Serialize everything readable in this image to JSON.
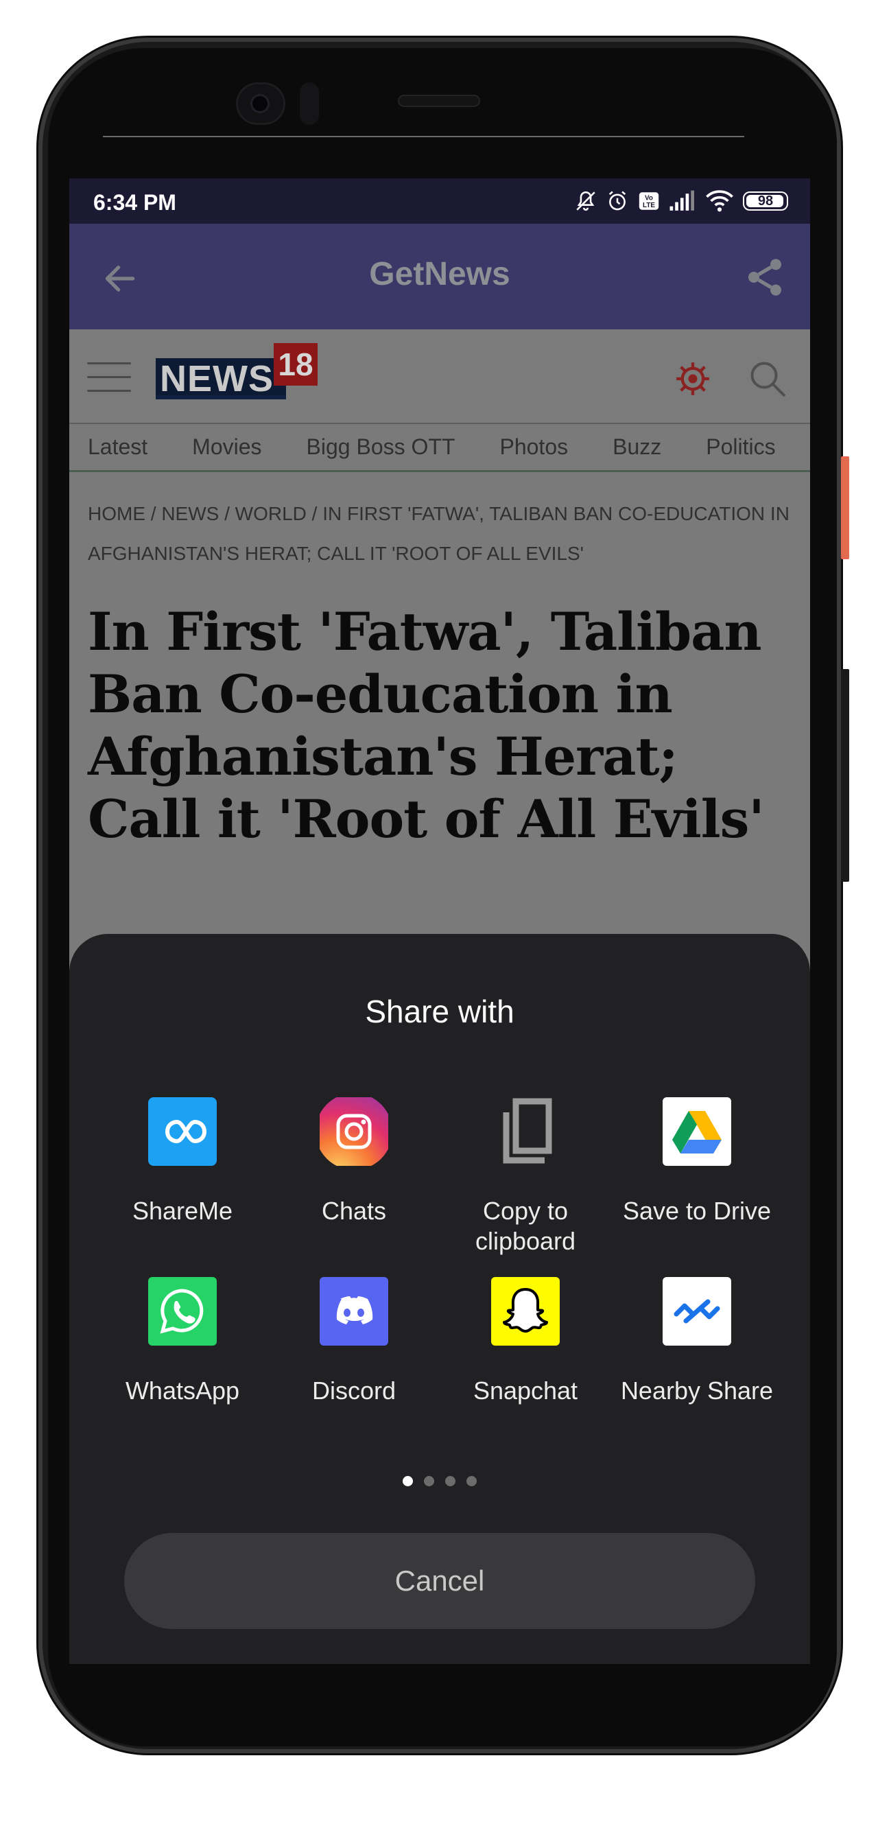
{
  "status_bar": {
    "time": "6:34 PM",
    "battery": "98",
    "icons": [
      "mute-icon",
      "alarm-icon",
      "volte-icon",
      "signal-icon",
      "wifi-icon",
      "battery-icon"
    ]
  },
  "app_bar": {
    "title": "GetNews",
    "back_icon": "back-arrow-icon",
    "share_icon": "share-icon"
  },
  "web": {
    "logo_text": "NEWS",
    "logo_number": "18",
    "nav": [
      "Latest",
      "Movies",
      "Bigg Boss OTT",
      "Photos",
      "Buzz",
      "Politics"
    ],
    "breadcrumb": "HOME / NEWS / WORLD / IN FIRST 'FATWA', TALIBAN BAN CO-EDUCATION IN AFGHANISTAN'S HERAT; CALL IT 'ROOT OF ALL EVILS'",
    "headline": "In First 'Fatwa', Taliban Ban Co-education in Afghanistan's Herat; Call it 'Root of All Evils'"
  },
  "share_sheet": {
    "title": "Share with",
    "items": [
      {
        "label": "ShareMe",
        "icon": "shareme-icon",
        "color": "#1da1f2"
      },
      {
        "label": "Chats",
        "icon": "instagram-icon",
        "color": "#e1306c"
      },
      {
        "label": "Copy to clipboard",
        "icon": "copy-icon",
        "color": "#9a9a9a"
      },
      {
        "label": "Save to Drive",
        "icon": "google-drive-icon",
        "color": "#ffffff"
      },
      {
        "label": "WhatsApp",
        "icon": "whatsapp-icon",
        "color": "#25d366"
      },
      {
        "label": "Discord",
        "icon": "discord-icon",
        "color": "#5865f2"
      },
      {
        "label": "Snapchat",
        "icon": "snapchat-icon",
        "color": "#fffc00"
      },
      {
        "label": "Nearby Share",
        "icon": "nearby-share-icon",
        "color": "#ffffff"
      }
    ],
    "pages": 4,
    "active_page": 1,
    "cancel_label": "Cancel"
  }
}
